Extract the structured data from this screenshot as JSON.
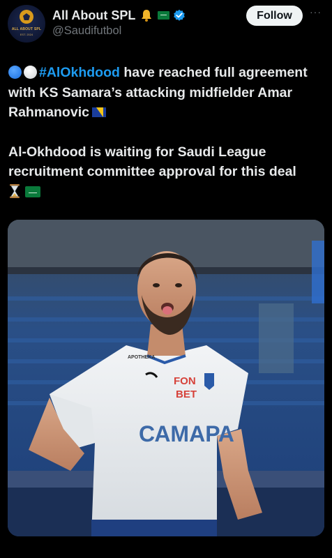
{
  "author": {
    "display_name": "All About SPL",
    "handle": "@Saudifutbol",
    "avatar_text": "ALL ABOUT SPL",
    "avatar_est": "EST. 2024"
  },
  "actions": {
    "follow_label": "Follow",
    "more_label": "···"
  },
  "tweet": {
    "hashtag": "#AlOkhdood",
    "line1_rest": " have reached full agreement with KS Samara’s attacking midfielder Amar Rahmanovic",
    "line2": "Al-Okhdood is waiting for Saudi League recruitment committee approval for this deal"
  },
  "media": {
    "sponsor_left": "APOTHEKA",
    "sponsor_main_1": "FON",
    "sponsor_main_2": "BET",
    "shirt_text": "САМАРА"
  },
  "colors": {
    "background": "#000000",
    "text": "#e7e9ea",
    "secondary": "#71767b",
    "link": "#1d9bf0",
    "follow_bg": "#eff3f4"
  },
  "icons": [
    "bell-icon",
    "saudi-flag-icon",
    "verified-icon",
    "more-icon",
    "blue-circle-icon",
    "white-circle-icon",
    "bosnia-flag-icon",
    "hourglass-icon"
  ]
}
